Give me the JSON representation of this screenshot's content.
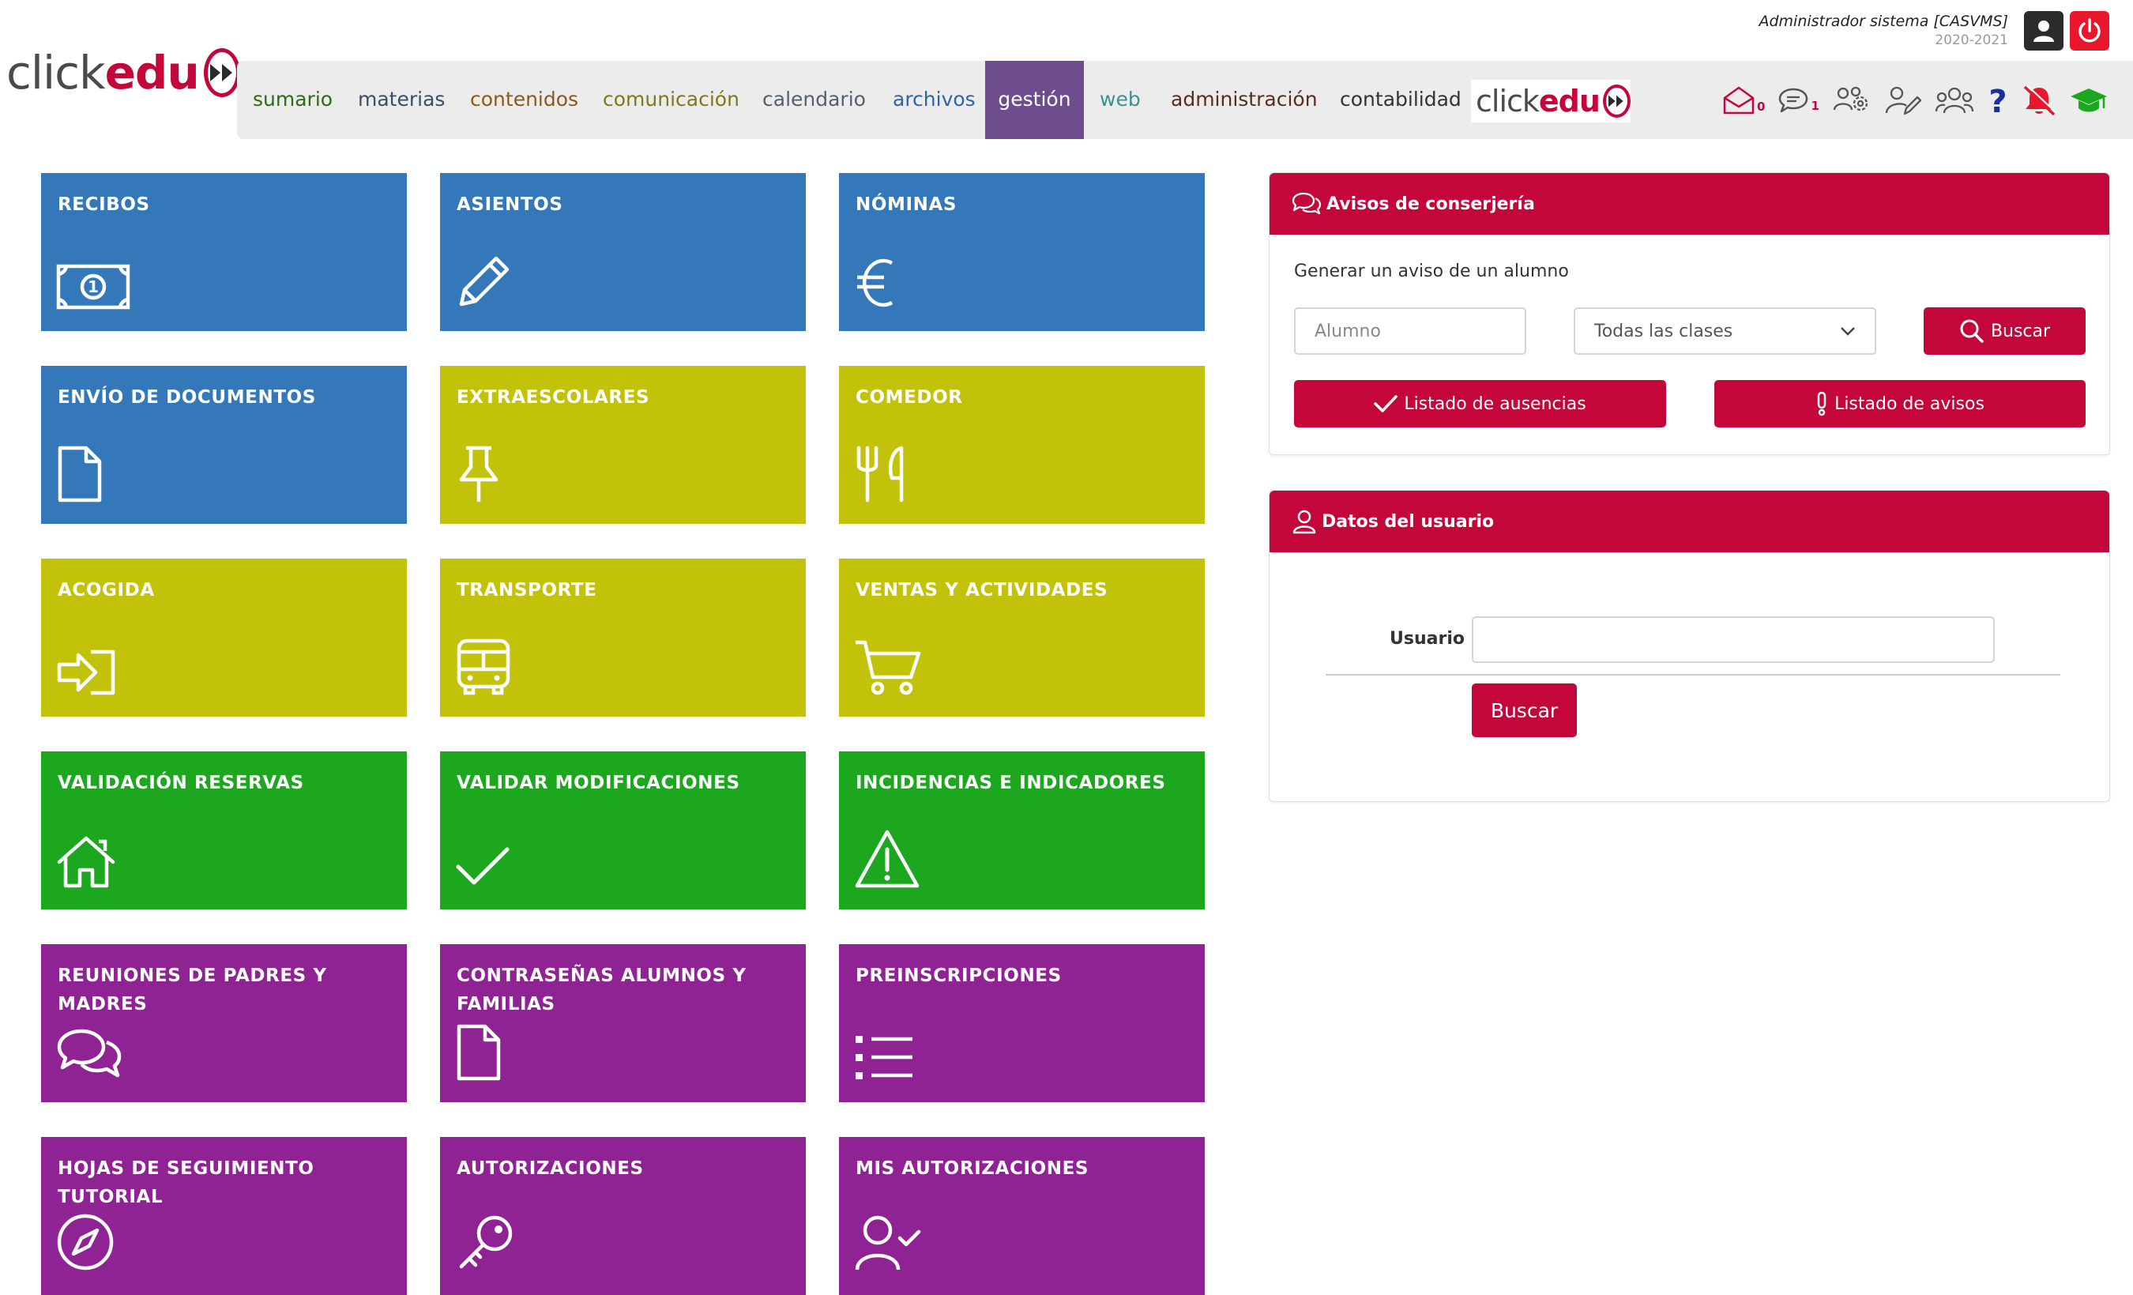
{
  "header": {
    "logo": {
      "part1": "click",
      "part2": "edu"
    },
    "user_name": "Administrador sistema [CASVMS]",
    "school_year": "2020-2021"
  },
  "nav": {
    "items": [
      {
        "label": "sumario",
        "color": "#2e6b14"
      },
      {
        "label": "materias",
        "color": "#3a4e6b"
      },
      {
        "label": "contenidos",
        "color": "#8a5a1a"
      },
      {
        "label": "comunicación",
        "color": "#7d7a1c"
      },
      {
        "label": "calendario",
        "color": "#555f6e"
      },
      {
        "label": "archivos",
        "color": "#2f64a8"
      },
      {
        "label": "gestión",
        "color": "#ffffff"
      },
      {
        "label": "web",
        "color": "#3f8f96"
      },
      {
        "label": "administración",
        "color": "#5a2f1a"
      },
      {
        "label": "contabilidad",
        "color": "#333333"
      }
    ],
    "active": "gestión",
    "mail_count": "0",
    "chat_count": "1"
  },
  "tiles": [
    {
      "label": "Recibos",
      "icon": "banknote-icon",
      "color": "blue"
    },
    {
      "label": "Asientos",
      "icon": "pencil-icon",
      "color": "blue"
    },
    {
      "label": "Nóminas",
      "icon": "euro-icon",
      "color": "blue"
    },
    {
      "label": "Envío de documentos",
      "icon": "document-icon",
      "color": "blue"
    },
    {
      "label": "Extraescolares",
      "icon": "pushpin-icon",
      "color": "olive"
    },
    {
      "label": "Comedor",
      "icon": "cutlery-icon",
      "color": "olive"
    },
    {
      "label": "Acogida",
      "icon": "sign-in-icon",
      "color": "olive"
    },
    {
      "label": "Transporte",
      "icon": "bus-icon",
      "color": "olive"
    },
    {
      "label": "Ventas y actividades",
      "icon": "cart-icon",
      "color": "olive"
    },
    {
      "label": "Validación reservas",
      "icon": "home-icon",
      "color": "green"
    },
    {
      "label": "Validar modificaciones",
      "icon": "check-icon",
      "color": "green"
    },
    {
      "label": "Incidencias e indicadores",
      "icon": "warning-icon",
      "color": "green"
    },
    {
      "label": "Reuniones de padres y madres",
      "icon": "chat-bubbles-icon",
      "color": "purple"
    },
    {
      "label": "Contraseñas alumnos y familias",
      "icon": "document-icon",
      "color": "purple"
    },
    {
      "label": "Preinscripciones",
      "icon": "list-icon",
      "color": "purple"
    },
    {
      "label": "Hojas de seguimiento tutorial",
      "icon": "compass-icon",
      "color": "purple"
    },
    {
      "label": "Autorizaciones",
      "icon": "key-icon",
      "color": "purple"
    },
    {
      "label": "Mis autorizaciones",
      "icon": "user-check-icon",
      "color": "purple"
    }
  ],
  "avisos": {
    "title": "Avisos de conserjería",
    "subtitle": "Generar un aviso de un alumno",
    "alumno_placeholder": "Alumno",
    "classes_selected": "Todas las clases",
    "search_label": "Buscar",
    "absences_label": "Listado de ausencias",
    "notices_label": "Listado de avisos"
  },
  "usuario": {
    "title": "Datos del usuario",
    "field_label": "Usuario",
    "field_value": "",
    "search_label": "Buscar"
  },
  "colors": {
    "brand_red": "#c4073a",
    "nav_active": "#6e4d8f",
    "tile_blue": "#3478b9",
    "tile_olive": "#c2c20b",
    "tile_green": "#1ca71f",
    "tile_purple": "#902393"
  }
}
